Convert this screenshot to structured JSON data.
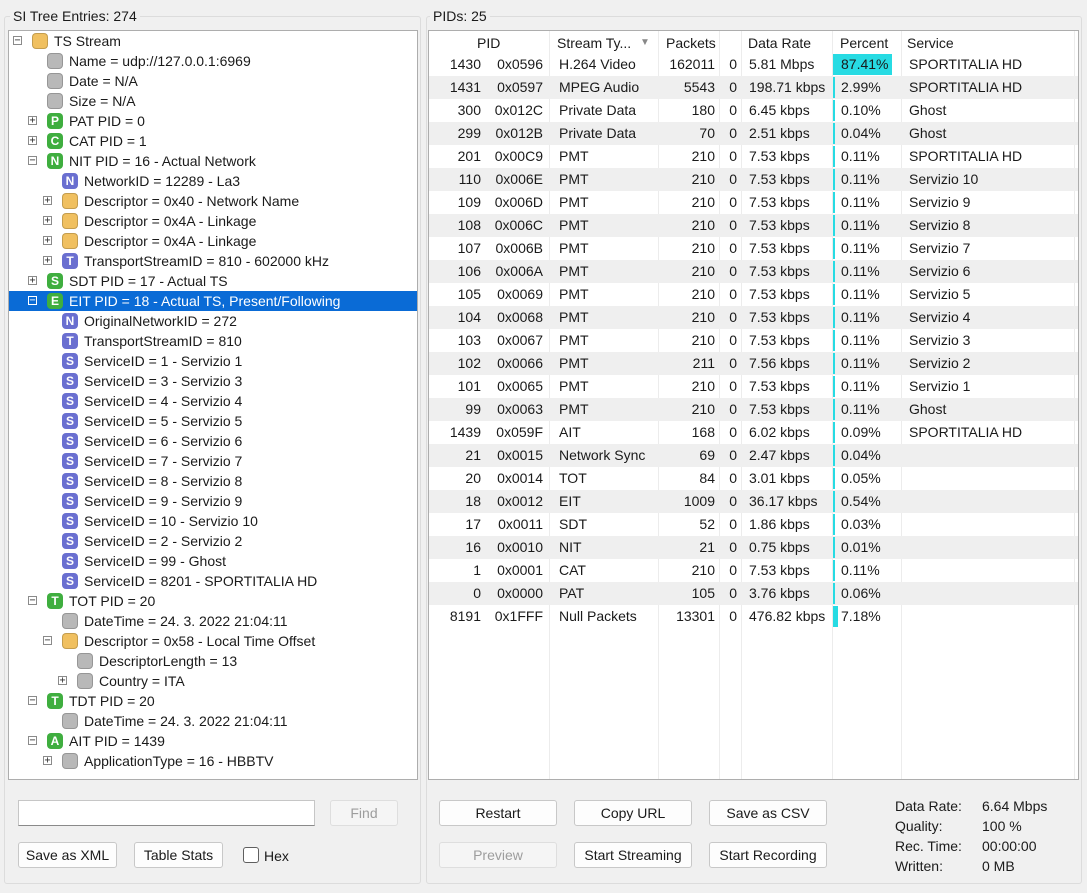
{
  "left_panel": {
    "title": "SI Tree Entries: 274"
  },
  "right_panel": {
    "title": "PIDs: 25"
  },
  "tree": [
    {
      "label": "TS Stream",
      "level": 0,
      "icon": "folder-icon",
      "expander": "-"
    },
    {
      "label": "Name = udp://127.0.0.1:6969",
      "level": 1,
      "icon": "gray-node-icon"
    },
    {
      "label": "Date = N/A",
      "level": 1,
      "icon": "gray-node-icon"
    },
    {
      "label": "Size = N/A",
      "level": 1,
      "icon": "gray-node-icon"
    },
    {
      "label": "PAT PID = 0",
      "level": 1,
      "icon": "green-letter-icon",
      "letter": "P",
      "expander": "+"
    },
    {
      "label": "CAT PID = 1",
      "level": 1,
      "icon": "green-letter-icon",
      "letter": "C",
      "expander": "+"
    },
    {
      "label": "NIT PID = 16 - Actual Network",
      "level": 1,
      "icon": "green-letter-icon",
      "letter": "N",
      "expander": "-"
    },
    {
      "label": "NetworkID = 12289 - La3",
      "level": 2,
      "icon": "purple-letter-icon",
      "letter": "N"
    },
    {
      "label": "Descriptor = 0x40 - Network Name",
      "level": 2,
      "icon": "folder-icon",
      "expander": "+"
    },
    {
      "label": "Descriptor = 0x4A - Linkage",
      "level": 2,
      "icon": "folder-icon",
      "expander": "+"
    },
    {
      "label": "Descriptor = 0x4A - Linkage",
      "level": 2,
      "icon": "folder-icon",
      "expander": "+"
    },
    {
      "label": "TransportStreamID = 810 - 602000 kHz",
      "level": 2,
      "icon": "purple-letter-icon",
      "letter": "T",
      "expander": "+"
    },
    {
      "label": "SDT PID = 17 - Actual TS",
      "level": 1,
      "icon": "green-letter-icon",
      "letter": "S",
      "expander": "+"
    },
    {
      "label": "EIT PID = 18 - Actual TS, Present/Following",
      "level": 1,
      "icon": "green-letter-icon",
      "letter": "E",
      "expander": "-",
      "selected": true
    },
    {
      "label": "OriginalNetworkID = 272",
      "level": 2,
      "icon": "purple-letter-icon",
      "letter": "N"
    },
    {
      "label": "TransportStreamID = 810",
      "level": 2,
      "icon": "purple-letter-icon",
      "letter": "T"
    },
    {
      "label": "ServiceID = 1 - Servizio 1",
      "level": 2,
      "icon": "purple-letter-icon",
      "letter": "S"
    },
    {
      "label": "ServiceID = 3 - Servizio 3",
      "level": 2,
      "icon": "purple-letter-icon",
      "letter": "S"
    },
    {
      "label": "ServiceID = 4 - Servizio 4",
      "level": 2,
      "icon": "purple-letter-icon",
      "letter": "S"
    },
    {
      "label": "ServiceID = 5 - Servizio 5",
      "level": 2,
      "icon": "purple-letter-icon",
      "letter": "S"
    },
    {
      "label": "ServiceID = 6 - Servizio 6",
      "level": 2,
      "icon": "purple-letter-icon",
      "letter": "S"
    },
    {
      "label": "ServiceID = 7 - Servizio 7",
      "level": 2,
      "icon": "purple-letter-icon",
      "letter": "S"
    },
    {
      "label": "ServiceID = 8 - Servizio 8",
      "level": 2,
      "icon": "purple-letter-icon",
      "letter": "S"
    },
    {
      "label": "ServiceID = 9 - Servizio 9",
      "level": 2,
      "icon": "purple-letter-icon",
      "letter": "S"
    },
    {
      "label": "ServiceID = 10 - Servizio 10",
      "level": 2,
      "icon": "purple-letter-icon",
      "letter": "S"
    },
    {
      "label": "ServiceID = 2 - Servizio 2",
      "level": 2,
      "icon": "purple-letter-icon",
      "letter": "S"
    },
    {
      "label": "ServiceID = 99 - Ghost",
      "level": 2,
      "icon": "purple-letter-icon",
      "letter": "S"
    },
    {
      "label": "ServiceID = 8201 - SPORTITALIA HD",
      "level": 2,
      "icon": "purple-letter-icon",
      "letter": "S"
    },
    {
      "label": "TOT PID = 20",
      "level": 1,
      "icon": "green-letter-icon",
      "letter": "T",
      "expander": "-"
    },
    {
      "label": "DateTime = 24. 3. 2022 21:04:11",
      "level": 2,
      "icon": "gray-node-icon"
    },
    {
      "label": "Descriptor = 0x58 - Local Time Offset",
      "level": 2,
      "icon": "folder-icon",
      "expander": "-"
    },
    {
      "label": "DescriptorLength = 13",
      "level": 3,
      "icon": "gray-node-icon"
    },
    {
      "label": "Country = ITA",
      "level": 3,
      "icon": "gray-node-icon",
      "expander": "+"
    },
    {
      "label": "TDT PID = 20",
      "level": 1,
      "icon": "green-letter-icon",
      "letter": "T",
      "expander": "-"
    },
    {
      "label": "DateTime = 24. 3. 2022 21:04:11",
      "level": 2,
      "icon": "gray-node-icon"
    },
    {
      "label": "AIT PID = 1439",
      "level": 1,
      "icon": "green-letter-icon",
      "letter": "A",
      "expander": "-"
    },
    {
      "label": "ApplicationType = 16 - HBBTV",
      "level": 2,
      "icon": "gray-node-icon",
      "expander": "+"
    }
  ],
  "left_controls": {
    "search_placeholder": "",
    "find_label": "Find",
    "save_xml_label": "Save as XML",
    "table_stats_label": "Table Stats",
    "hex_label": "Hex"
  },
  "table": {
    "headers": {
      "pid": "PID",
      "stream_type": "Stream Ty...",
      "packets": "Packets",
      "data_rate": "Data Rate",
      "percent": "Percent",
      "service": "Service"
    },
    "rows": [
      {
        "pid": "1430",
        "hex": "0x0596",
        "type": "H.264 Video",
        "packets": "162011",
        "cc": "0",
        "rate": "5.81 Mbps",
        "percent": "87.41%",
        "pct": 87.41,
        "service": "SPORTITALIA HD"
      },
      {
        "pid": "1431",
        "hex": "0x0597",
        "type": "MPEG Audio",
        "packets": "5543",
        "cc": "0",
        "rate": "198.71 kbps",
        "percent": "2.99%",
        "pct": 2.99,
        "service": "SPORTITALIA HD"
      },
      {
        "pid": "300",
        "hex": "0x012C",
        "type": "Private Data",
        "packets": "180",
        "cc": "0",
        "rate": "6.45 kbps",
        "percent": "0.10%",
        "pct": 0.1,
        "service": "Ghost"
      },
      {
        "pid": "299",
        "hex": "0x012B",
        "type": "Private Data",
        "packets": "70",
        "cc": "0",
        "rate": "2.51 kbps",
        "percent": "0.04%",
        "pct": 0.04,
        "service": "Ghost"
      },
      {
        "pid": "201",
        "hex": "0x00C9",
        "type": "PMT",
        "packets": "210",
        "cc": "0",
        "rate": "7.53 kbps",
        "percent": "0.11%",
        "pct": 0.11,
        "service": "SPORTITALIA HD"
      },
      {
        "pid": "110",
        "hex": "0x006E",
        "type": "PMT",
        "packets": "210",
        "cc": "0",
        "rate": "7.53 kbps",
        "percent": "0.11%",
        "pct": 0.11,
        "service": "Servizio 10"
      },
      {
        "pid": "109",
        "hex": "0x006D",
        "type": "PMT",
        "packets": "210",
        "cc": "0",
        "rate": "7.53 kbps",
        "percent": "0.11%",
        "pct": 0.11,
        "service": "Servizio 9"
      },
      {
        "pid": "108",
        "hex": "0x006C",
        "type": "PMT",
        "packets": "210",
        "cc": "0",
        "rate": "7.53 kbps",
        "percent": "0.11%",
        "pct": 0.11,
        "service": "Servizio 8"
      },
      {
        "pid": "107",
        "hex": "0x006B",
        "type": "PMT",
        "packets": "210",
        "cc": "0",
        "rate": "7.53 kbps",
        "percent": "0.11%",
        "pct": 0.11,
        "service": "Servizio 7"
      },
      {
        "pid": "106",
        "hex": "0x006A",
        "type": "PMT",
        "packets": "210",
        "cc": "0",
        "rate": "7.53 kbps",
        "percent": "0.11%",
        "pct": 0.11,
        "service": "Servizio 6"
      },
      {
        "pid": "105",
        "hex": "0x0069",
        "type": "PMT",
        "packets": "210",
        "cc": "0",
        "rate": "7.53 kbps",
        "percent": "0.11%",
        "pct": 0.11,
        "service": "Servizio 5"
      },
      {
        "pid": "104",
        "hex": "0x0068",
        "type": "PMT",
        "packets": "210",
        "cc": "0",
        "rate": "7.53 kbps",
        "percent": "0.11%",
        "pct": 0.11,
        "service": "Servizio 4"
      },
      {
        "pid": "103",
        "hex": "0x0067",
        "type": "PMT",
        "packets": "210",
        "cc": "0",
        "rate": "7.53 kbps",
        "percent": "0.11%",
        "pct": 0.11,
        "service": "Servizio 3"
      },
      {
        "pid": "102",
        "hex": "0x0066",
        "type": "PMT",
        "packets": "211",
        "cc": "0",
        "rate": "7.56 kbps",
        "percent": "0.11%",
        "pct": 0.11,
        "service": "Servizio 2"
      },
      {
        "pid": "101",
        "hex": "0x0065",
        "type": "PMT",
        "packets": "210",
        "cc": "0",
        "rate": "7.53 kbps",
        "percent": "0.11%",
        "pct": 0.11,
        "service": "Servizio 1"
      },
      {
        "pid": "99",
        "hex": "0x0063",
        "type": "PMT",
        "packets": "210",
        "cc": "0",
        "rate": "7.53 kbps",
        "percent": "0.11%",
        "pct": 0.11,
        "service": "Ghost"
      },
      {
        "pid": "1439",
        "hex": "0x059F",
        "type": "AIT",
        "packets": "168",
        "cc": "0",
        "rate": "6.02 kbps",
        "percent": "0.09%",
        "pct": 0.09,
        "service": "SPORTITALIA HD"
      },
      {
        "pid": "21",
        "hex": "0x0015",
        "type": "Network Sync",
        "packets": "69",
        "cc": "0",
        "rate": "2.47 kbps",
        "percent": "0.04%",
        "pct": 0.04,
        "service": ""
      },
      {
        "pid": "20",
        "hex": "0x0014",
        "type": "TOT",
        "packets": "84",
        "cc": "0",
        "rate": "3.01 kbps",
        "percent": "0.05%",
        "pct": 0.05,
        "service": ""
      },
      {
        "pid": "18",
        "hex": "0x0012",
        "type": "EIT",
        "packets": "1009",
        "cc": "0",
        "rate": "36.17 kbps",
        "percent": "0.54%",
        "pct": 0.54,
        "service": ""
      },
      {
        "pid": "17",
        "hex": "0x0011",
        "type": "SDT",
        "packets": "52",
        "cc": "0",
        "rate": "1.86 kbps",
        "percent": "0.03%",
        "pct": 0.03,
        "service": ""
      },
      {
        "pid": "16",
        "hex": "0x0010",
        "type": "NIT",
        "packets": "21",
        "cc": "0",
        "rate": "0.75 kbps",
        "percent": "0.01%",
        "pct": 0.01,
        "service": ""
      },
      {
        "pid": "1",
        "hex": "0x0001",
        "type": "CAT",
        "packets": "210",
        "cc": "0",
        "rate": "7.53 kbps",
        "percent": "0.11%",
        "pct": 0.11,
        "service": ""
      },
      {
        "pid": "0",
        "hex": "0x0000",
        "type": "PAT",
        "packets": "105",
        "cc": "0",
        "rate": "3.76 kbps",
        "percent": "0.06%",
        "pct": 0.06,
        "service": ""
      },
      {
        "pid": "8191",
        "hex": "0x1FFF",
        "type": "Null Packets",
        "packets": "13301",
        "cc": "0",
        "rate": "476.82 kbps",
        "percent": "7.18%",
        "pct": 7.18,
        "service": ""
      }
    ]
  },
  "right_controls": {
    "restart_label": "Restart",
    "copy_url_label": "Copy URL",
    "save_csv_label": "Save as CSV",
    "preview_label": "Preview",
    "start_streaming_label": "Start Streaming",
    "start_recording_label": "Start Recording"
  },
  "stats": {
    "data_rate_label": "Data Rate:",
    "data_rate_value": "6.64 Mbps",
    "quality_label": "Quality:",
    "quality_value": "100 %",
    "rec_time_label": "Rec. Time:",
    "rec_time_value": "00:00:00",
    "written_label": "Written:",
    "written_value": "0 MB"
  },
  "colors": {
    "selection": "#0a6bd6",
    "percent_bar": "#27dbe3",
    "green_icon": "#3fae3f",
    "purple_icon": "#6a6fd0",
    "folder_icon": "#f0c060",
    "gray_icon": "#b8b8b8"
  }
}
